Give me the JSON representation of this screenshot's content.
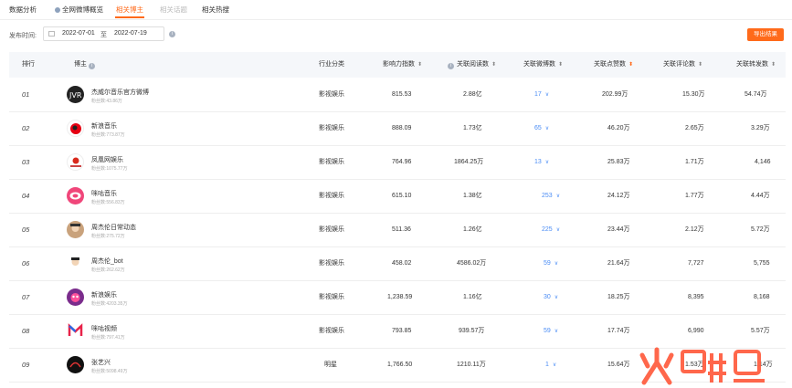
{
  "tabs": [
    {
      "label": "数据分析"
    },
    {
      "label": "全网微博概览"
    },
    {
      "label": "相关博主"
    },
    {
      "label": "相关话题"
    },
    {
      "label": "相关热搜"
    }
  ],
  "filter": {
    "label": "发布时间:",
    "start": "2022-07-01",
    "separator": "至",
    "end": "2022-07-19"
  },
  "export_label": "导出结果",
  "columns": {
    "rank": "排行",
    "blogger": "博主",
    "industry": "行业分类",
    "influence": "影响力指数",
    "reads": "关联阅读数",
    "posts": "关联微博数",
    "likes": "关联点赞数",
    "comments": "关联评论数",
    "reposts": "关联转发数"
  },
  "rows": [
    {
      "rank": "01",
      "name": "杰威尔音乐官方微博",
      "fans": "粉丝数:43.86万",
      "industry": "影视娱乐",
      "influence": "815.53",
      "reads": "2.88亿",
      "posts": "17",
      "likes": "202.99万",
      "comments": "15.30万",
      "reposts": "54.74万"
    },
    {
      "rank": "02",
      "name": "新浪音乐",
      "fans": "粉丝数:773.87万",
      "industry": "影视娱乐",
      "influence": "888.09",
      "reads": "1.73亿",
      "posts": "65",
      "likes": "46.20万",
      "comments": "2.65万",
      "reposts": "3.29万"
    },
    {
      "rank": "03",
      "name": "凤凰网娱乐",
      "fans": "粉丝数:1075.77万",
      "industry": "影视娱乐",
      "influence": "764.96",
      "reads": "1864.25万",
      "posts": "13",
      "likes": "25.83万",
      "comments": "1.71万",
      "reposts": "4,146"
    },
    {
      "rank": "04",
      "name": "咪咕音乐",
      "fans": "粉丝数:556.83万",
      "industry": "影视娱乐",
      "influence": "615.10",
      "reads": "1.38亿",
      "posts": "253",
      "likes": "24.12万",
      "comments": "1.77万",
      "reposts": "4.44万"
    },
    {
      "rank": "05",
      "name": "周杰伦日常动态",
      "fans": "粉丝数:275.72万",
      "industry": "影视娱乐",
      "influence": "511.36",
      "reads": "1.26亿",
      "posts": "225",
      "likes": "23.44万",
      "comments": "2.12万",
      "reposts": "5.72万"
    },
    {
      "rank": "06",
      "name": "周杰伦_bot",
      "fans": "粉丝数:262.62万",
      "industry": "影视娱乐",
      "influence": "458.02",
      "reads": "4586.02万",
      "posts": "59",
      "likes": "21.64万",
      "comments": "7,727",
      "reposts": "5,755"
    },
    {
      "rank": "07",
      "name": "新浪娱乐",
      "fans": "粉丝数:4203.35万",
      "industry": "影视娱乐",
      "influence": "1,238.59",
      "reads": "1.16亿",
      "posts": "30",
      "likes": "18.25万",
      "comments": "8,395",
      "reposts": "8,168"
    },
    {
      "rank": "08",
      "name": "咪咕视频",
      "fans": "粉丝数:797.41万",
      "industry": "影视娱乐",
      "influence": "793.85",
      "reads": "939.57万",
      "posts": "59",
      "likes": "17.74万",
      "comments": "6,990",
      "reposts": "5.57万"
    },
    {
      "rank": "09",
      "name": "张艺兴",
      "fans": "粉丝数:5098.49万",
      "industry": "明星",
      "influence": "1,766.50",
      "reads": "1210.11万",
      "posts": "1",
      "likes": "15.64万",
      "comments": "1.53万",
      "reposts": "1.14万"
    }
  ],
  "colors": {
    "accent": "#ff6a1a",
    "link": "#4a8cf5"
  }
}
